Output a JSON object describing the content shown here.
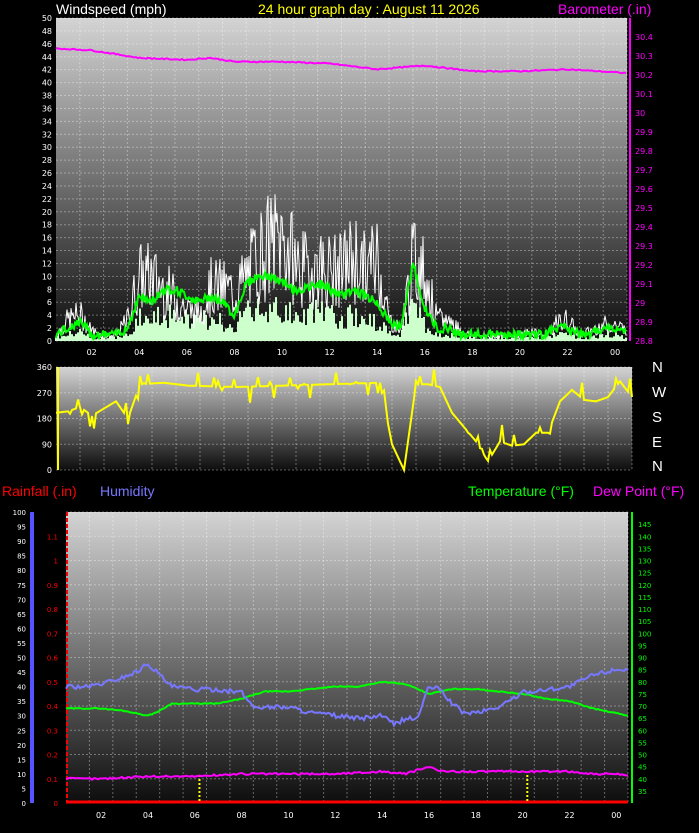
{
  "header": {
    "windspeed_label": "Windspeed (mph)",
    "title": "24 hour graph day : August 11 2026",
    "barometer_label": "Barometer (.in)"
  },
  "lower_header": {
    "rainfall_label": "Rainfall (.in)",
    "humidity_label": "Humidity",
    "temperature_label": "Temperature (°F)",
    "dewpoint_label": "Dew Point (°F)"
  },
  "compass": [
    "N",
    "W",
    "S",
    "E",
    "N"
  ],
  "colors": {
    "gust": "#ffffff",
    "average_wind": "#00ff00",
    "wind_fill": "#ccffcc",
    "barometer": "#ff00ff",
    "direction": "#ffff00",
    "humidity": "#7777ff",
    "temperature": "#00ff00",
    "dewpoint": "#ff00ff",
    "rainfall": "#ff0000",
    "left_axis_bar": "#5555ff"
  },
  "chart_data": [
    {
      "type": "line",
      "panel": "wind_barometer",
      "x_ticks": [
        "02",
        "04",
        "06",
        "08",
        "10",
        "12",
        "14",
        "16",
        "18",
        "20",
        "22",
        "00"
      ],
      "x_hours": [
        0.5,
        24.5
      ],
      "ylim_left": [
        0,
        50
      ],
      "ylim_right": [
        28.8,
        30.5
      ],
      "left_ticks": [
        "0",
        "2",
        "4",
        "6",
        "8",
        "10",
        "12",
        "14",
        "16",
        "18",
        "20",
        "22",
        "24",
        "26",
        "28",
        "30",
        "32",
        "34",
        "36",
        "38",
        "40",
        "42",
        "44",
        "46",
        "48",
        "50"
      ],
      "right_ticks": [
        "28.8",
        "28.9",
        "29",
        "29.1",
        "29.2",
        "29.3",
        "29.4",
        "29.5",
        "29.6",
        "29.7",
        "29.8",
        "29.9",
        "30",
        "30.1",
        "30.2",
        "30.3",
        "30.4"
      ],
      "grid": true,
      "series": [
        {
          "axis": "left",
          "x": [
            0.5,
            1,
            1.5,
            2,
            2.5,
            3,
            3.5,
            4,
            4.5,
            5,
            5.5,
            6,
            6.5,
            7,
            7.5,
            8,
            8.5,
            9,
            9.5,
            10,
            10.5,
            11,
            11.5,
            12,
            12.5,
            13,
            13.5,
            14,
            14.5,
            15,
            15.5,
            16,
            16.5,
            17,
            17.5,
            18,
            18.5,
            19,
            19.5,
            20,
            20.5,
            21,
            21.5,
            22,
            22.5,
            23,
            23.5,
            24,
            24.5
          ],
          "values": [
            1,
            4,
            5,
            2,
            1,
            1,
            4,
            12,
            12,
            10,
            8,
            6,
            5,
            10,
            10,
            9,
            12,
            16,
            18,
            19,
            15,
            13,
            14,
            13,
            13,
            16,
            13,
            16,
            4,
            2,
            15,
            13,
            4,
            4,
            2,
            1,
            1,
            1,
            1,
            1,
            2,
            1,
            3,
            4,
            1,
            2,
            3,
            3,
            2
          ]
        },
        {
          "axis": "left",
          "x": [
            0.5,
            1,
            1.5,
            2,
            2.5,
            3,
            3.5,
            4,
            4.5,
            5,
            5.5,
            6,
            6.5,
            7,
            7.5,
            8,
            8.5,
            9,
            9.5,
            10,
            10.5,
            11,
            11.5,
            12,
            12.5,
            13,
            13.5,
            14,
            14.5,
            15,
            15.5,
            16,
            16.5,
            17,
            17.5,
            18,
            18.5,
            19,
            19.5,
            20,
            20.5,
            21,
            21.5,
            22,
            22.5,
            23,
            23.5,
            24,
            24.5
          ],
          "values": [
            1,
            2,
            3,
            1,
            1,
            1,
            2,
            7,
            6,
            8,
            8,
            7,
            6,
            7,
            6,
            4,
            9,
            10,
            10,
            9,
            8,
            8,
            9,
            8,
            7,
            8,
            7,
            6,
            3,
            2,
            12,
            5,
            2,
            2,
            1,
            1,
            1,
            1,
            1,
            1,
            1,
            1,
            2,
            2,
            1,
            1,
            2,
            2,
            1
          ]
        },
        {
          "axis": "right",
          "x": [
            0.5,
            2,
            4,
            6,
            7,
            8,
            10,
            12,
            14,
            16,
            18,
            20,
            22,
            24.5
          ],
          "values": [
            30.34,
            30.33,
            30.29,
            30.28,
            30.29,
            30.27,
            30.27,
            30.26,
            30.23,
            30.25,
            30.22,
            30.22,
            30.23,
            30.21
          ]
        }
      ]
    },
    {
      "type": "line",
      "panel": "wind_direction",
      "x_ticks": [
        "02",
        "04",
        "06",
        "08",
        "10",
        "12",
        "14",
        "16",
        "18",
        "20",
        "22",
        "00"
      ],
      "ylim": [
        0,
        360
      ],
      "y_ticks": [
        "0",
        "90",
        "180",
        "270",
        "360"
      ],
      "grid": true,
      "series": [
        {
          "x": [
            0.5,
            1,
            1.5,
            2,
            2.5,
            3,
            3.5,
            4,
            5,
            6,
            8,
            10,
            12,
            14,
            14.5,
            15,
            15.5,
            16,
            16.5,
            17,
            17.5,
            18,
            18.5,
            19,
            19.5,
            20,
            20.5,
            21,
            21.5,
            22,
            22.5,
            23,
            23.5,
            24,
            24.5
          ],
          "values": [
            200,
            205,
            220,
            190,
            215,
            240,
            180,
            300,
            305,
            295,
            290,
            295,
            300,
            305,
            90,
            0,
            300,
            300,
            290,
            200,
            150,
            100,
            30,
            100,
            85,
            90,
            130,
            130,
            240,
            280,
            245,
            240,
            255,
            310,
            255
          ]
        }
      ]
    },
    {
      "type": "line",
      "panel": "rain_humidity_temperature",
      "x_ticks": [
        "02",
        "04",
        "06",
        "08",
        "10",
        "12",
        "14",
        "16",
        "18",
        "20",
        "22",
        "00"
      ],
      "ylim_humidity": [
        0,
        100
      ],
      "humidity_ticks": [
        "0",
        "5",
        "10",
        "15",
        "20",
        "25",
        "30",
        "35",
        "40",
        "45",
        "50",
        "55",
        "60",
        "65",
        "70",
        "75",
        "80",
        "85",
        "90",
        "95",
        "100"
      ],
      "ylim_rainfall": [
        0,
        1.2
      ],
      "rainfall_ticks": [
        "0",
        "0.1",
        "0.2",
        "0.3",
        "0.4",
        "0.5",
        "0.6",
        "0.7",
        "0.8",
        "0.9",
        "1",
        "1.1"
      ],
      "ylim_temperature": [
        30,
        150
      ],
      "temperature_ticks": [
        "35",
        "40",
        "45",
        "50",
        "55",
        "60",
        "65",
        "70",
        "75",
        "80",
        "85",
        "90",
        "95",
        "100",
        "105",
        "110",
        "115",
        "120",
        "125",
        "130",
        "135",
        "140",
        "145"
      ],
      "grid": true,
      "series": [
        {
          "name": "Humidity",
          "axis": "humidity",
          "x": [
            0.5,
            1.5,
            2.5,
            3.5,
            4,
            4.5,
            5,
            6,
            7,
            8,
            8.5,
            9,
            10,
            11,
            12,
            13,
            14,
            14.5,
            15,
            15.5,
            16,
            16.5,
            17,
            17.5,
            18,
            18.5,
            19,
            20,
            21,
            22,
            23,
            24,
            24.5
          ],
          "values": [
            40,
            40,
            42,
            45,
            48,
            44,
            40,
            39,
            39,
            38,
            33,
            33,
            33,
            31,
            30,
            29,
            30,
            27,
            29,
            29,
            40,
            39,
            34,
            31,
            31,
            32,
            33,
            38,
            39,
            40,
            44,
            46,
            46
          ]
        },
        {
          "name": "Temperature",
          "axis": "temperature",
          "x": [
            0.5,
            1,
            2,
            3,
            4,
            4.5,
            5,
            6,
            7,
            8,
            9,
            10,
            11,
            12,
            13,
            14,
            15,
            15.5,
            16,
            16.5,
            17,
            18,
            19,
            20,
            21,
            22,
            23,
            24,
            24.5
          ],
          "values": [
            69,
            69,
            69,
            68,
            66,
            68,
            71,
            71,
            71,
            73,
            76,
            76,
            77,
            78,
            78,
            80,
            79,
            77,
            75,
            76,
            77,
            77,
            76,
            75,
            73,
            72,
            69,
            67,
            66
          ]
        },
        {
          "name": "Dew Point",
          "axis": "temperature",
          "x": [
            0.5,
            2,
            4,
            6,
            8,
            10,
            12,
            14,
            15,
            16,
            16.5,
            17,
            18,
            19,
            20,
            21,
            22,
            23,
            24,
            24.5
          ],
          "values": [
            40,
            40,
            41,
            41,
            42,
            42,
            42,
            43,
            42,
            45,
            43,
            43,
            43,
            43,
            43,
            43,
            43,
            42,
            42,
            41
          ]
        }
      ]
    }
  ]
}
